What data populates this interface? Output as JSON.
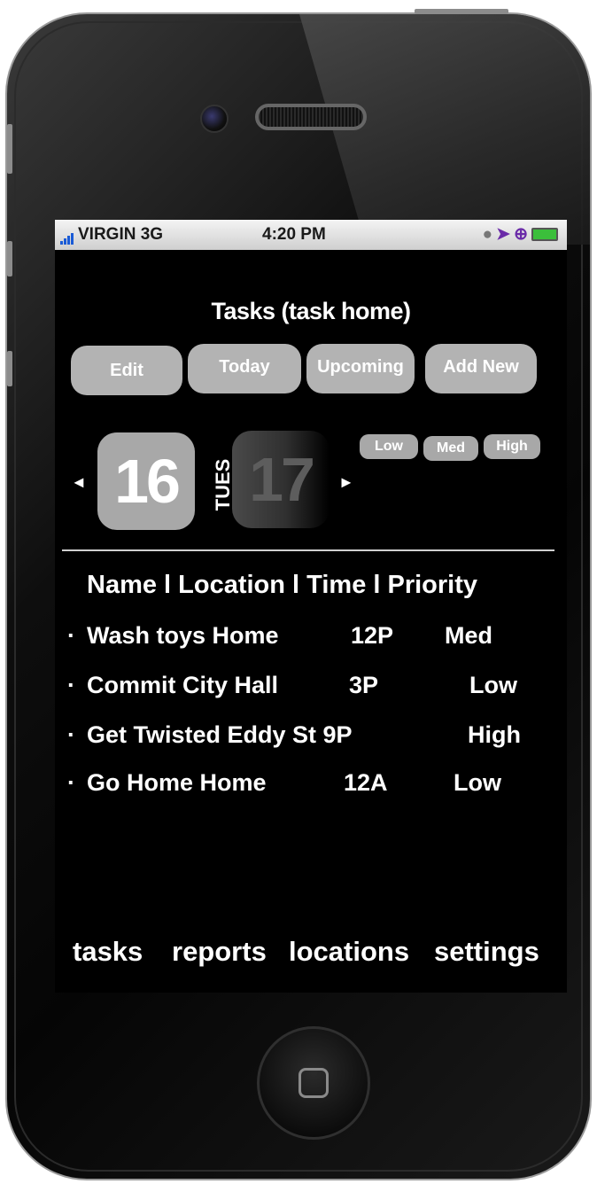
{
  "status": {
    "carrier": "VIRGIN 3G",
    "time": "4:20 PM",
    "icons": [
      "lock-icon",
      "location-arrow-icon",
      "alarm-icon",
      "battery-icon"
    ]
  },
  "title": "Tasks (task home)",
  "toolbar": {
    "edit": "Edit",
    "today": "Today",
    "upcoming": "Upcoming",
    "add_new": "Add New"
  },
  "date": {
    "current": "16",
    "day": "TUES",
    "next": "17",
    "prev_arrow": "◄",
    "next_arrow": "►"
  },
  "priority_filter": {
    "low": "Low",
    "med": "Med",
    "high": "High"
  },
  "table": {
    "header": "Name l Location l Time l Priority",
    "rows": [
      {
        "bullet": "·",
        "name": "Wash toys Home",
        "time": "12P",
        "priority": "Med"
      },
      {
        "bullet": "·",
        "name": "Commit City Hall",
        "time": "3P",
        "priority": "Low"
      },
      {
        "bullet": "·",
        "name": "Get Twisted Eddy St 9P",
        "time": "",
        "priority": "High"
      },
      {
        "bullet": "·",
        "name": "Go Home Home",
        "time": "12A",
        "priority": "Low"
      }
    ]
  },
  "tabbar": {
    "tasks": "tasks",
    "reports": "reports",
    "locations": "locations",
    "settings": "settings"
  },
  "colors": {
    "button_gray": "#b3b3b3",
    "screen_bg": "#000000",
    "text": "#ffffff"
  }
}
